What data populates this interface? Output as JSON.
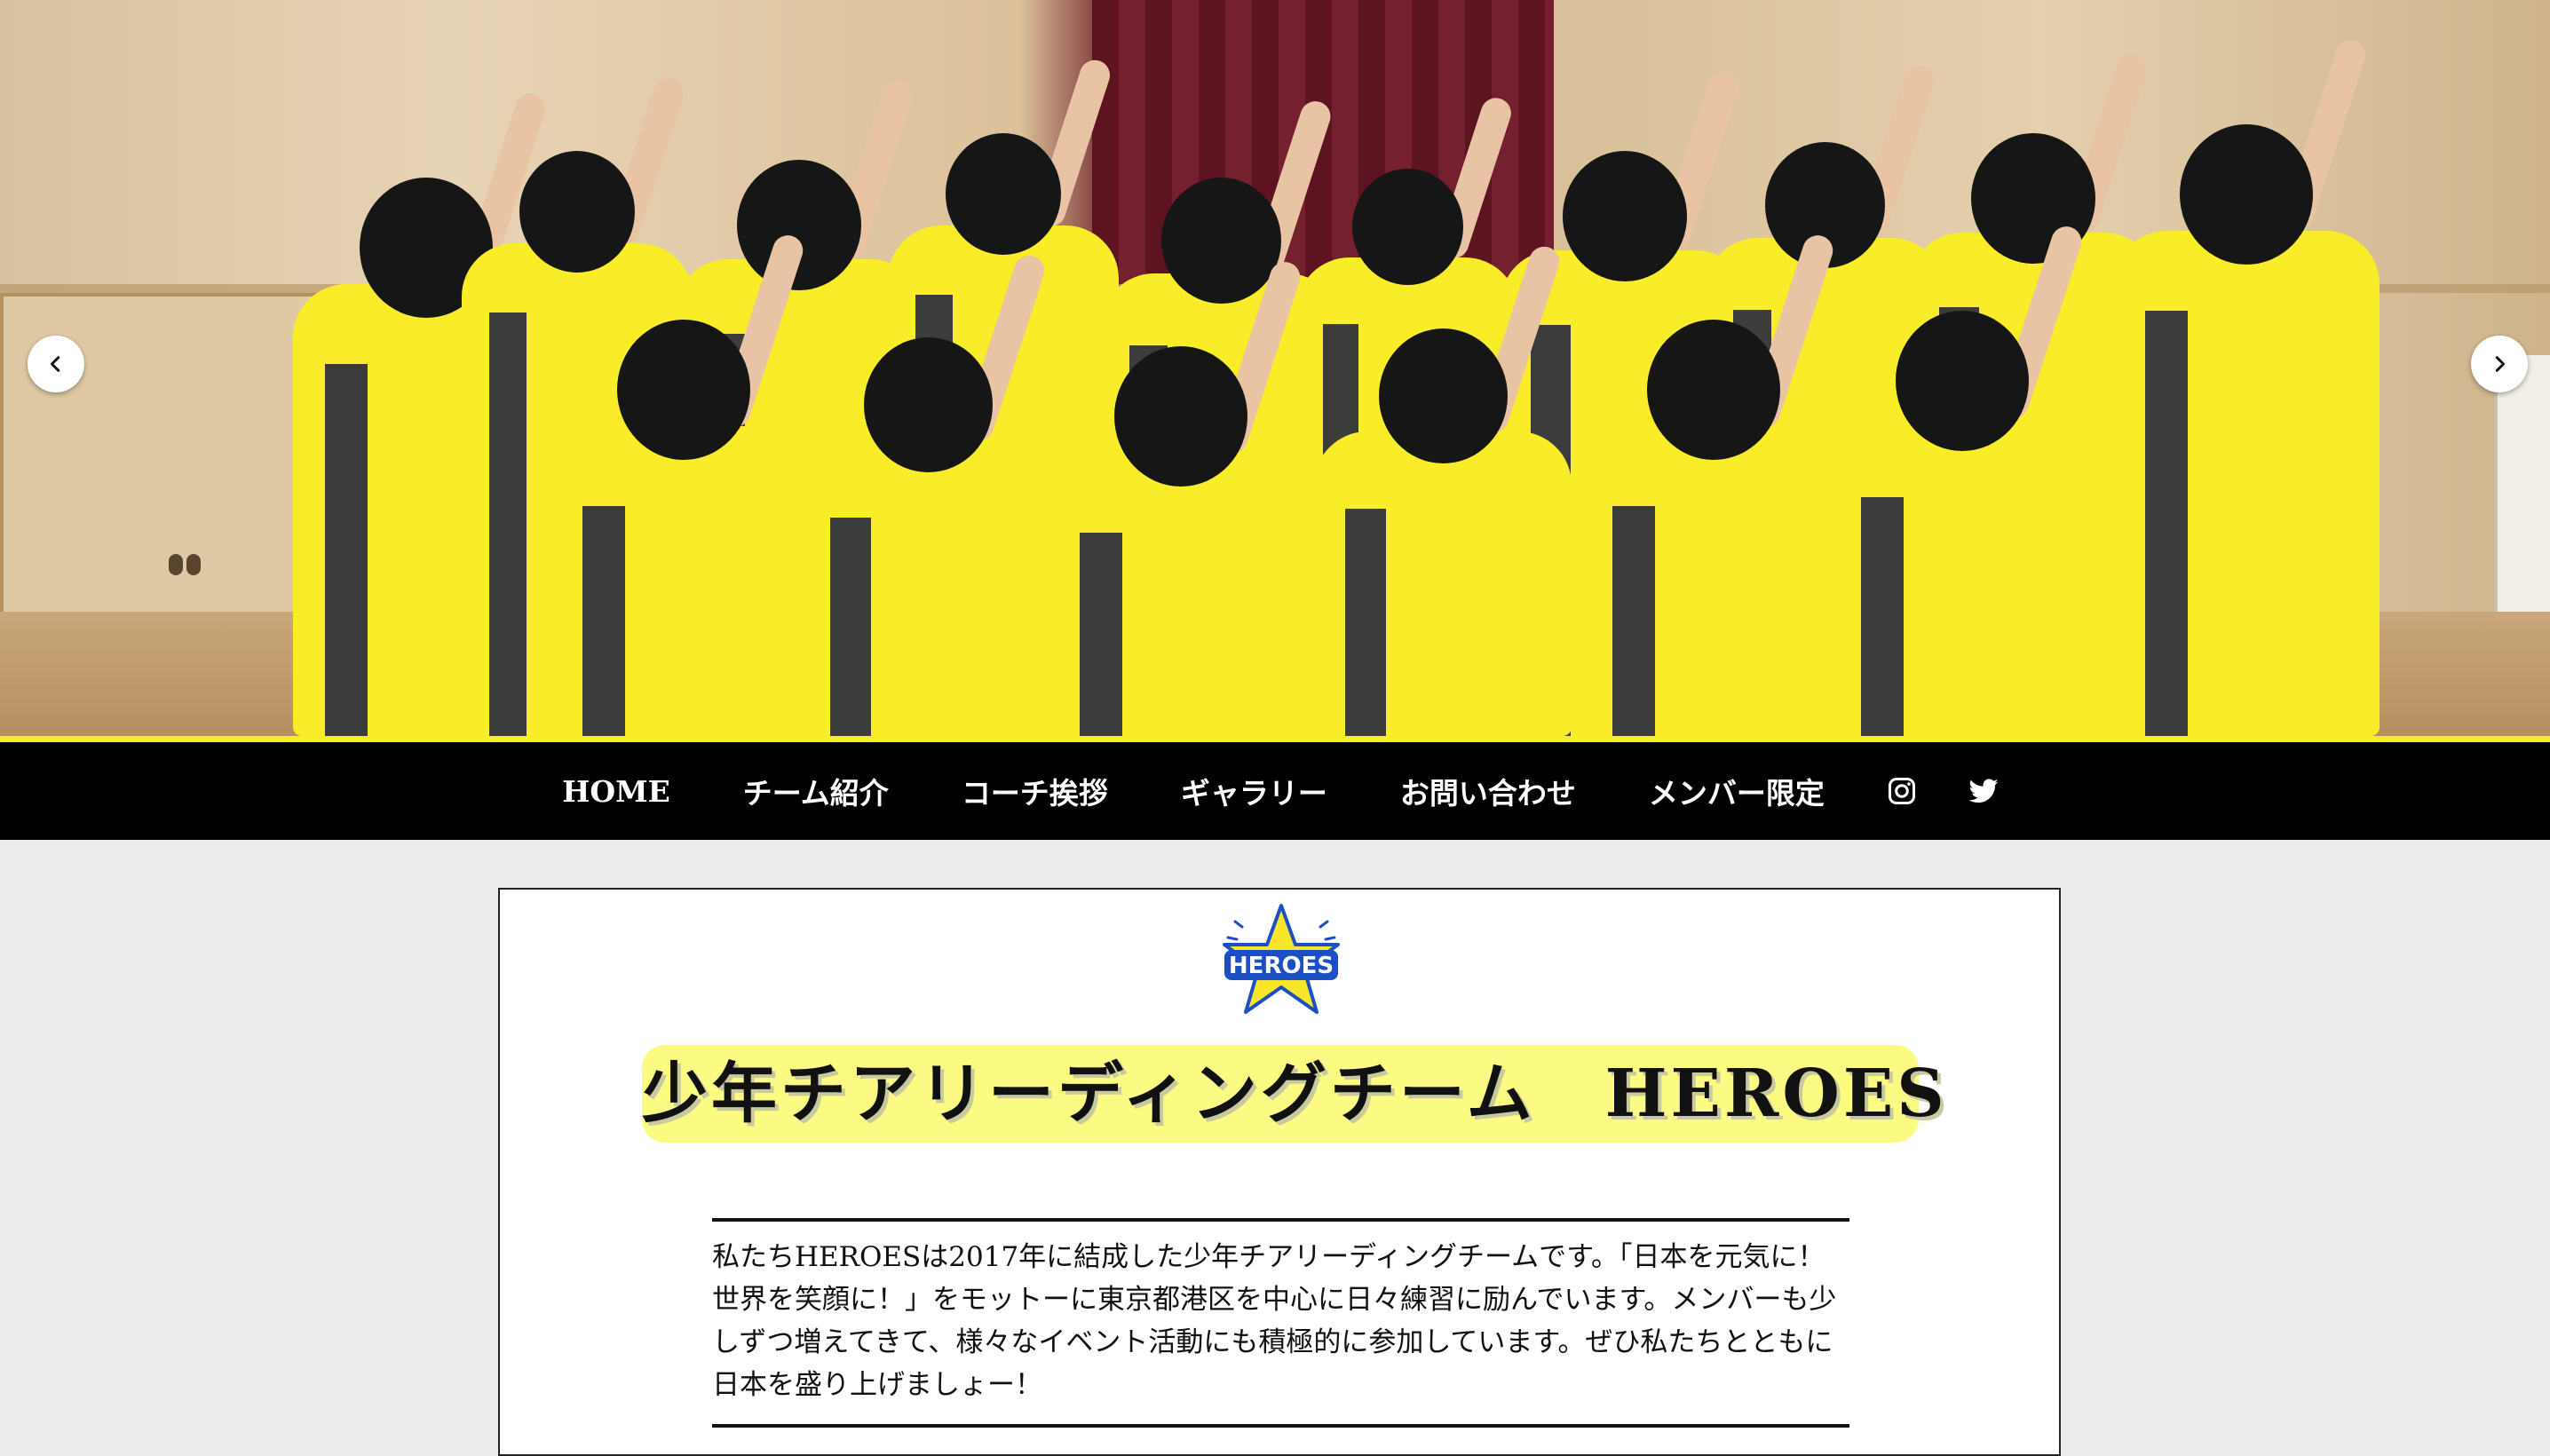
{
  "hero": {
    "prev_label": "previous slide",
    "next_label": "next slide"
  },
  "nav": {
    "items": [
      {
        "label": "HOME"
      },
      {
        "label": "チーム紹介"
      },
      {
        "label": "コーチ挨拶"
      },
      {
        "label": "ギャラリー"
      },
      {
        "label": "お問い合わせ"
      },
      {
        "label": "メンバー限定"
      }
    ],
    "icons": [
      "instagram-icon",
      "twitter-icon"
    ]
  },
  "content": {
    "logo_text": "HEROES",
    "title": "少年チアリーディングチーム　HEROES",
    "intro": "私たちHEROESは2017年に結成した少年チアリーディングチームです。「日本を元気に！世界を笑顔に！」をモットーに東京都港区を中心に日々練習に励んでいます。メンバーも少しずつ増えてきて、様々なイベント活動にも積極的に参加しています。ぜひ私たちとともに日本を盛り上げましょー！"
  },
  "colors": {
    "accent_yellow": "#f6ee2b",
    "title_highlight": "#fbfa83",
    "nav_background": "#000000",
    "page_background": "#ececec",
    "logo_blue": "#1c4fc4"
  }
}
